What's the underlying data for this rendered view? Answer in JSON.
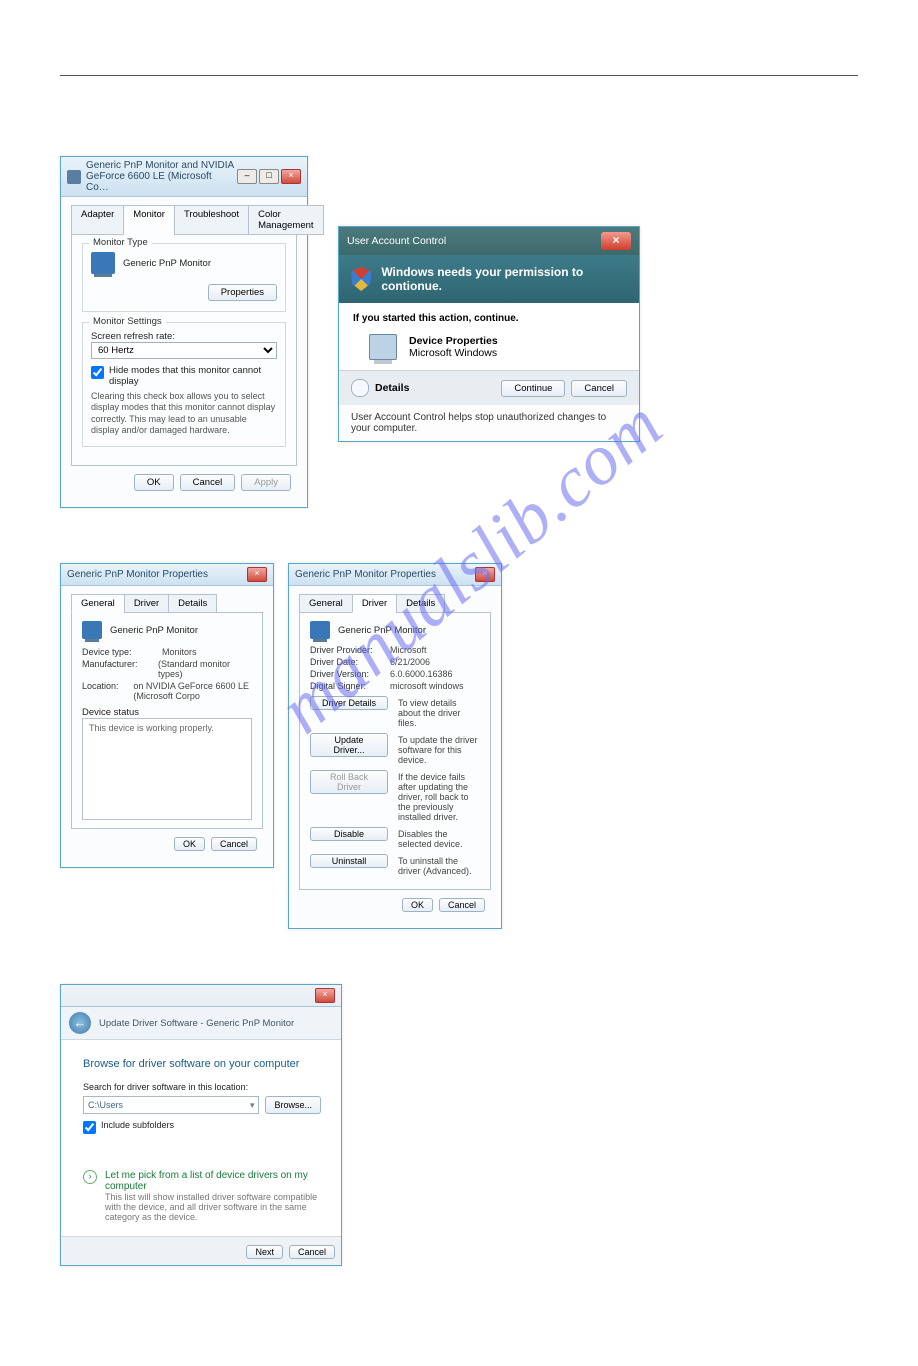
{
  "watermark": "manualslib.com",
  "dlg1": {
    "title": "Generic PnP Monitor and NVIDIA GeForce 6600 LE (Microsoft Co…",
    "tabs": [
      "Adapter",
      "Monitor",
      "Troubleshoot",
      "Color Management"
    ],
    "monitor_type_label": "Monitor Type",
    "monitor_name": "Generic PnP Monitor",
    "properties_btn": "Properties",
    "settings_label": "Monitor Settings",
    "refresh_label": "Screen refresh rate:",
    "refresh_value": "60 Hertz",
    "hide_modes": "Hide modes that this monitor cannot display",
    "hide_note": "Clearing this check box allows you to select display modes that this monitor cannot display correctly. This may lead to an unusable display and/or damaged hardware.",
    "ok": "OK",
    "cancel": "Cancel",
    "apply": "Apply"
  },
  "uac": {
    "title": "User Account Control",
    "banner": "Windows needs your permission to contionue.",
    "started": "If you started this action, continue.",
    "app": "Device Properties",
    "vendor": "Microsoft Windows",
    "details": "Details",
    "continue": "Continue",
    "cancel": "Cancel",
    "help": "User Account Control helps stop unauthorized changes to your computer."
  },
  "general": {
    "title": "Generic PnP Monitor Properties",
    "tabs": [
      "General",
      "Driver",
      "Details"
    ],
    "monitor_name": "Generic PnP Monitor",
    "device_type_k": "Device type:",
    "device_type_v": "Monitors",
    "manufacturer_k": "Manufacturer:",
    "manufacturer_v": "(Standard monitor types)",
    "location_k": "Location:",
    "location_v": "on NVIDIA GeForce 6600 LE (Microsoft Corpo",
    "status_label": "Device status",
    "status_text": "This device is working properly.",
    "ok": "OK",
    "cancel": "Cancel"
  },
  "driver": {
    "title": "Generic PnP Monitor Properties",
    "tabs": [
      "General",
      "Driver",
      "Details"
    ],
    "monitor_name": "Generic PnP Monitor",
    "provider_k": "Driver Provider:",
    "provider_v": "Microsoft",
    "date_k": "Driver Date:",
    "date_v": "6/21/2006",
    "version_k": "Driver Version:",
    "version_v": "6.0.6000.16386",
    "signer_k": "Digital Signer:",
    "signer_v": "microsoft windows",
    "details_btn": "Driver Details",
    "details_desc": "To view details about the driver files.",
    "update_btn": "Update Driver...",
    "update_desc": "To update the driver software for this device.",
    "rollback_btn": "Roll Back Driver",
    "rollback_desc": "If the device fails after updating the driver, roll back to the previously installed driver.",
    "disable_btn": "Disable",
    "disable_desc": "Disables the selected device.",
    "uninstall_btn": "Uninstall",
    "uninstall_desc": "To uninstall the driver (Advanced).",
    "ok": "OK",
    "cancel": "Cancel"
  },
  "update": {
    "breadcrumb": "Update Driver Software - Generic PnP Monitor",
    "heading": "Browse for driver software on your computer",
    "search_label": "Search for driver software in this location:",
    "path_value": "C:\\Users",
    "browse": "Browse...",
    "include": "Include subfolders",
    "pick_link": "Let me pick from a list of device drivers on my computer",
    "pick_sub": "This list will show installed driver software compatible with the device, and all driver software in the same category as the device.",
    "next": "Next",
    "cancel": "Cancel"
  }
}
